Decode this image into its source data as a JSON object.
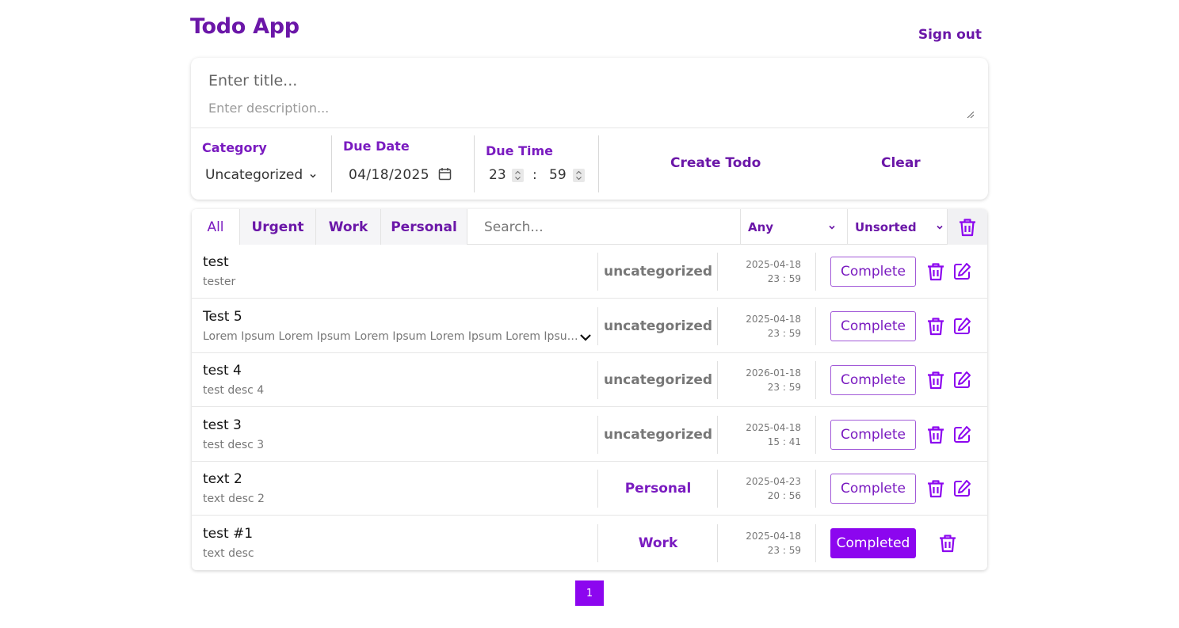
{
  "header": {
    "title": "Todo App",
    "signout_label": "Sign out"
  },
  "form": {
    "title_placeholder": "Enter title...",
    "description_placeholder": "Enter description...",
    "category_label": "Category",
    "category_value": "Uncategorized",
    "due_date_label": "Due Date",
    "due_date_value": "04/18/2025",
    "due_time_label": "Due Time",
    "due_hour": "23",
    "due_minute": "59",
    "time_separator": ":",
    "create_label": "Create Todo",
    "clear_label": "Clear"
  },
  "toolbar": {
    "tabs": [
      {
        "label": "All",
        "active": true
      },
      {
        "label": "Urgent"
      },
      {
        "label": "Work"
      },
      {
        "label": "Personal"
      }
    ],
    "search_placeholder": "Search...",
    "filter_value": "Any",
    "sort_value": "Unsorted",
    "bulk_delete_icon": "trash-icon"
  },
  "todos": [
    {
      "title": "test",
      "description": "tester",
      "category": "uncategorized",
      "date": "2025-04-18",
      "time": "23 : 59",
      "status_label": "Complete",
      "completed": false
    },
    {
      "title": "Test 5",
      "description": "Lorem Ipsum Lorem Ipsum Lorem Ipsum Lorem Ipsum Lorem Ipsum Lorem Ipsum",
      "category": "uncategorized",
      "date": "2025-04-18",
      "time": "23 : 59",
      "status_label": "Complete",
      "completed": false,
      "expandable": true
    },
    {
      "title": "test 4",
      "description": "test desc 4",
      "category": "uncategorized",
      "date": "2026-01-18",
      "time": "23 : 59",
      "status_label": "Complete",
      "completed": false
    },
    {
      "title": "test 3",
      "description": "test desc 3",
      "category": "uncategorized",
      "date": "2025-04-18",
      "time": "15 : 41",
      "status_label": "Complete",
      "completed": false
    },
    {
      "title": "text 2",
      "description": "text desc 2",
      "category": "Personal",
      "date": "2025-04-23",
      "time": "20 : 56",
      "status_label": "Complete",
      "completed": false
    },
    {
      "title": "test #1",
      "description": "text desc",
      "category": "Work",
      "date": "2025-04-18",
      "time": "23 : 59",
      "status_label": "Completed",
      "completed": true
    }
  ],
  "pagination": {
    "current": "1"
  },
  "colors": {
    "accent": "#7a1bc0",
    "accent_dark": "#6b17a8",
    "button_fill": "#8c06ef",
    "muted": "#777777"
  }
}
